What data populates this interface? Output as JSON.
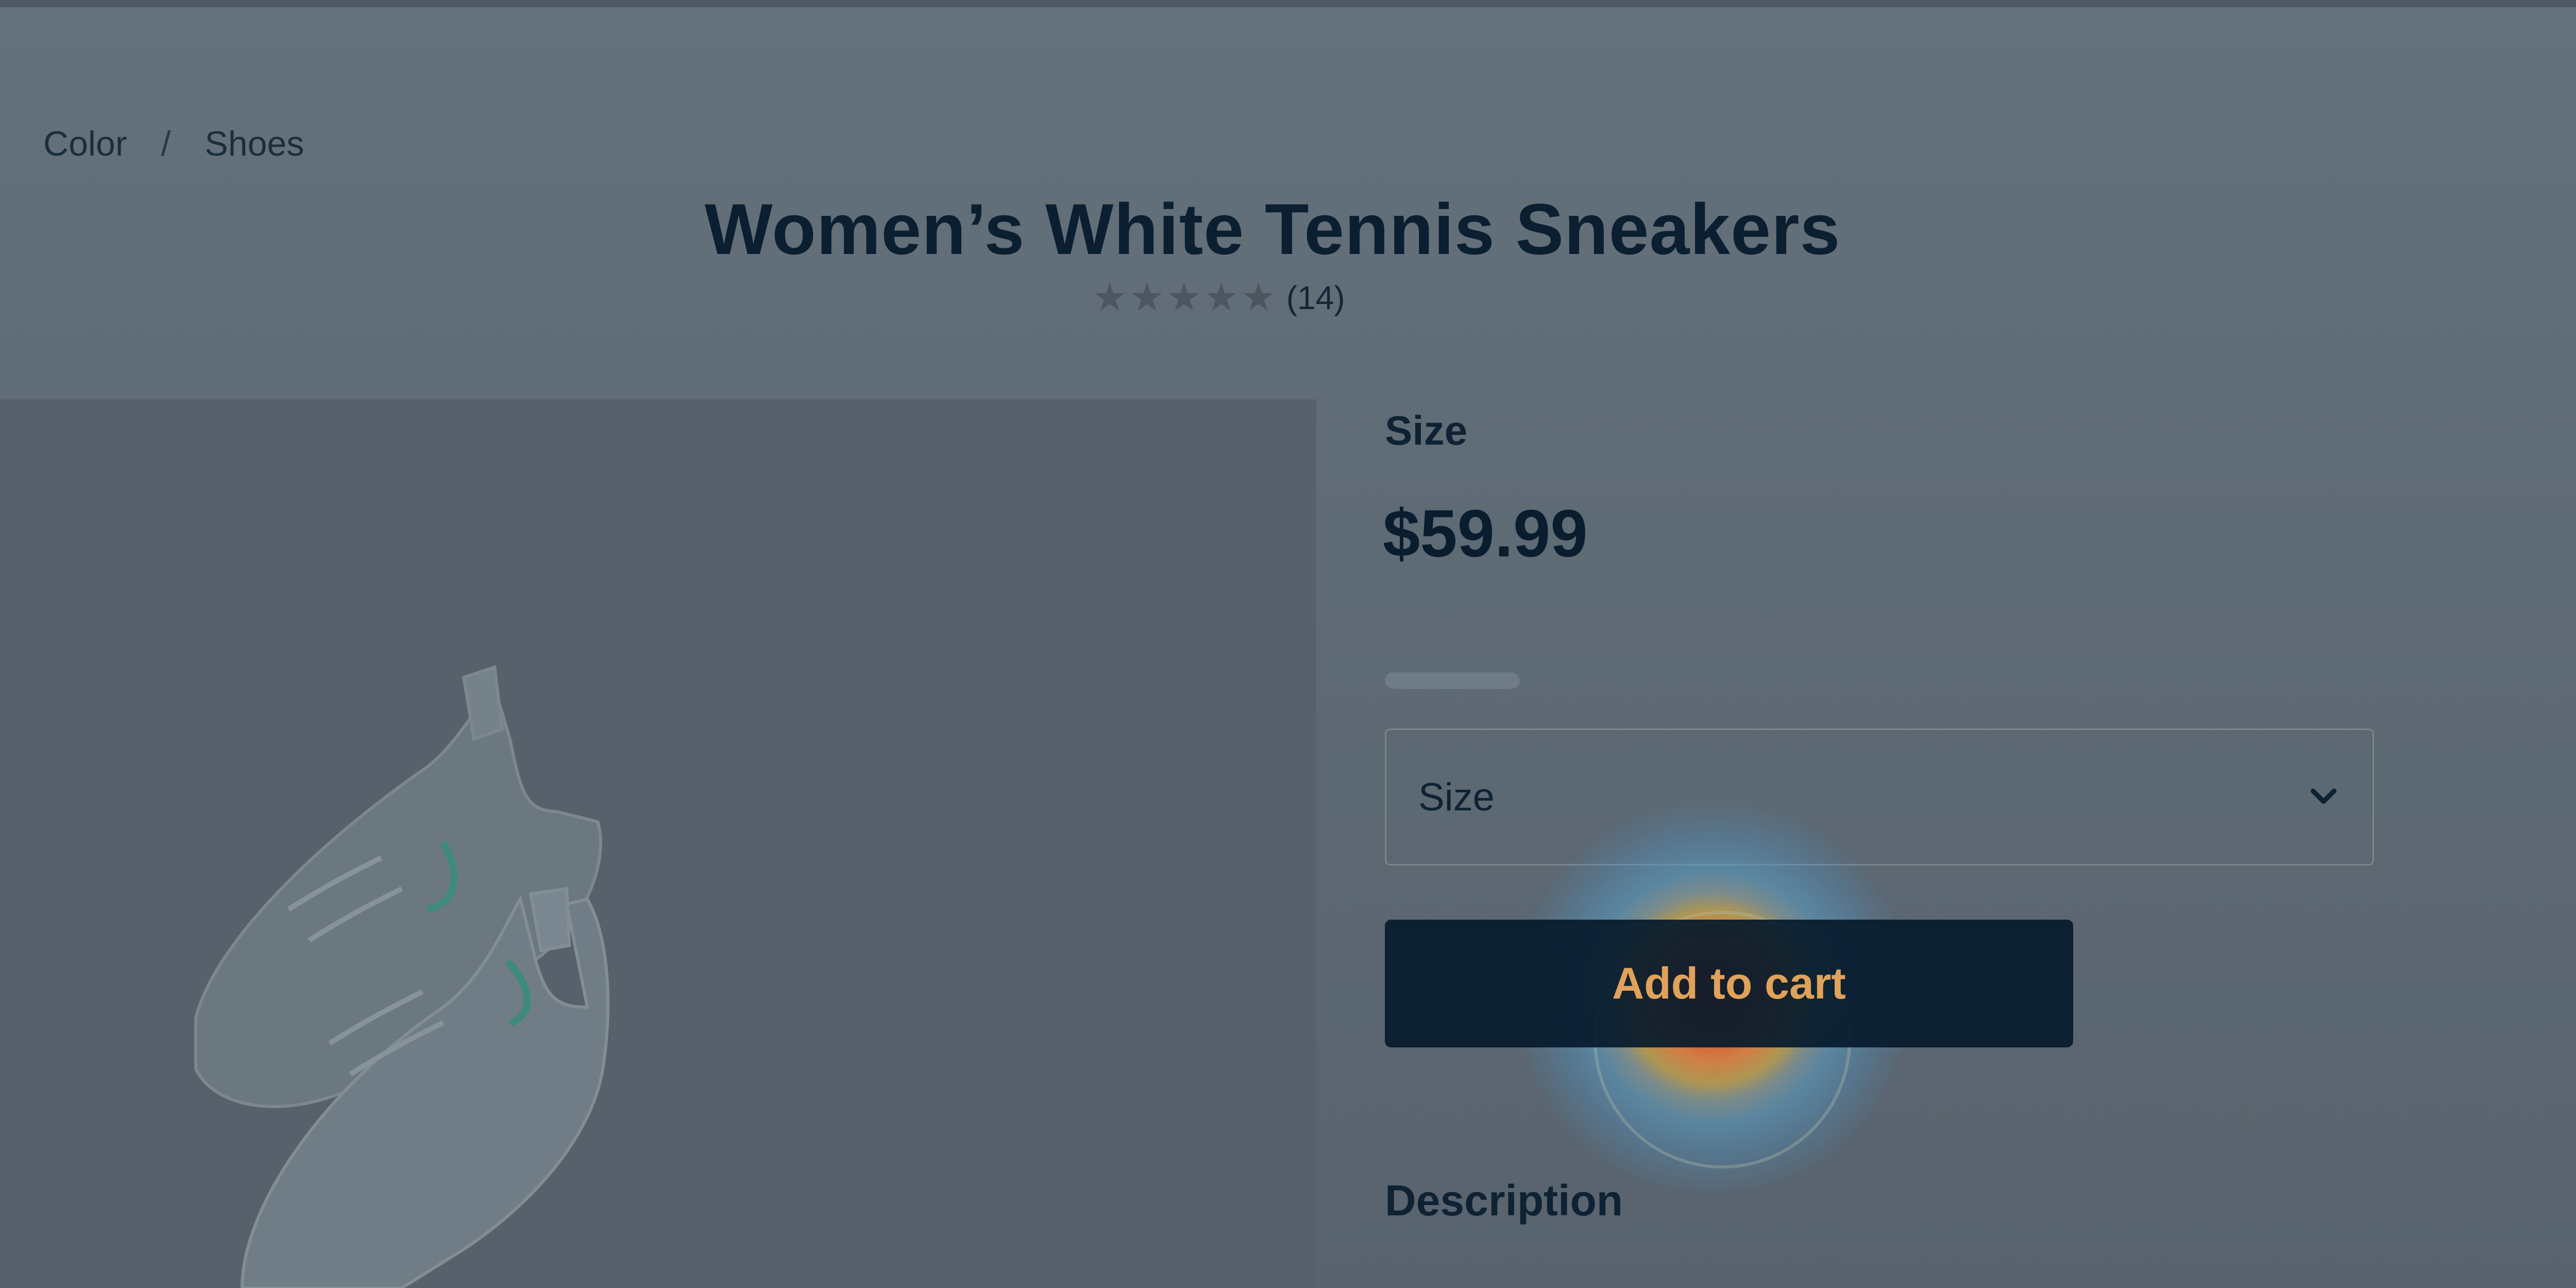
{
  "breadcrumb": {
    "items": [
      "Color",
      "Shoes"
    ],
    "separator": "/"
  },
  "product": {
    "title": "Women’s White Tennis Sneakers",
    "rating_stars": 0,
    "rating_max": 5,
    "review_count": "(14)",
    "size_heading": "Size",
    "price": "$59.99",
    "size_select_value": "Size",
    "add_to_cart_label": "Add to cart",
    "description_heading": "Description"
  },
  "icons": {
    "star": "star-icon",
    "chevron": "chevron-down-icon"
  },
  "colors": {
    "button_bg": "#051a2b",
    "button_text": "#e0a25a",
    "heat_center": "#d6341e",
    "heat_edge": "#50a0d0"
  }
}
